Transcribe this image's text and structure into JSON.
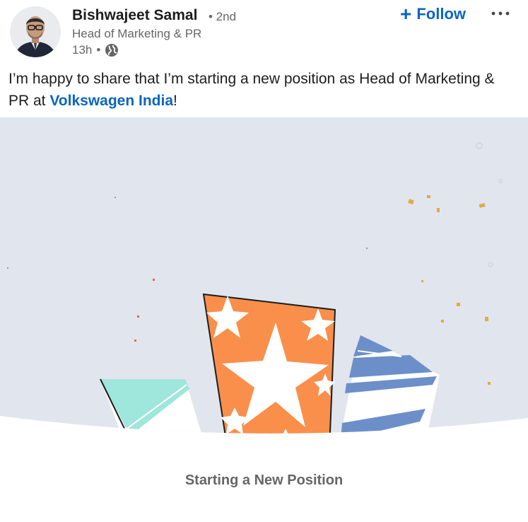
{
  "author": {
    "name": "Bishwajeet Samal",
    "degree": "• 2nd",
    "headline": "Head of Marketing & PR",
    "time": "13h",
    "visibility_icon": "globe-icon"
  },
  "actions": {
    "follow_label": "Follow",
    "follow_icon": "plus-icon",
    "more_icon": "ellipsis-icon"
  },
  "post": {
    "text_before": "I’m happy to share that I’m starting a new position as Head of Marketing & PR at ",
    "mention": "Volkswagen India",
    "text_after": "!"
  },
  "card": {
    "caption": "Starting a New Position"
  },
  "colors": {
    "accent": "#0a66c2",
    "hero_background": "#e1e5ee",
    "orange_gift": "#f98f4b",
    "teal_gift": "#9fe6dc",
    "blue_gift": "#6d8fc9",
    "confetti": "#e0ab3f"
  }
}
